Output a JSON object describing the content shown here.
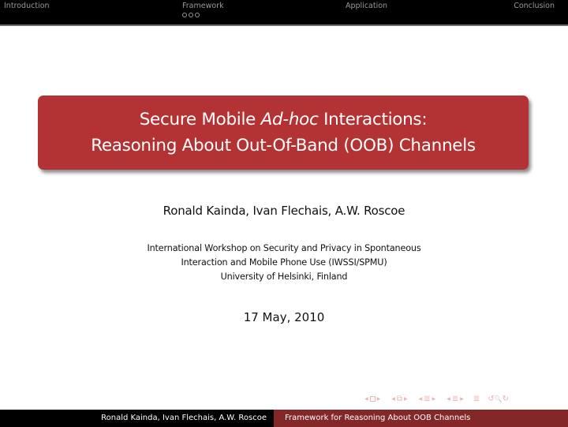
{
  "headline": {
    "sections": [
      {
        "label": "Introduction",
        "bullets": 0
      },
      {
        "label": "Framework",
        "bullets": 3
      },
      {
        "label": "Application",
        "bullets": 0
      },
      {
        "label": "Conclusion",
        "bullets": 0
      }
    ]
  },
  "title": {
    "line1_pre": "Secure Mobile ",
    "line1_italic": "Ad-hoc",
    "line1_post": " Interactions:",
    "line2": "Reasoning About Out-Of-Band (OOB) Channels"
  },
  "authors": "Ronald Kainda, Ivan Flechais, A.W. Roscoe",
  "institute": {
    "line1": "International Workshop on Security and Privacy in Spontaneous",
    "line2": "Interaction and Mobile Phone Use (IWSSI/SPMU)",
    "line3": "University of Helsinki, Finland"
  },
  "date": "17 May, 2010",
  "nav_symbols": {
    "left_arrow": "◀",
    "right_arrow": "▶",
    "frame_icon": "□",
    "subsection_icon": "⧉",
    "section_icon": "≣",
    "doc_icon": "≣",
    "undo": "↺",
    "search": "🔍",
    "redo": "↻"
  },
  "footer": {
    "authors": "Ronald Kainda, Ivan Flechais, A.W. Roscoe",
    "short_title": "Framework for Reasoning About OOB Channels"
  },
  "colors": {
    "title_box": "#b33234",
    "footer_right": "#832728",
    "headline_bg": "#000000"
  }
}
